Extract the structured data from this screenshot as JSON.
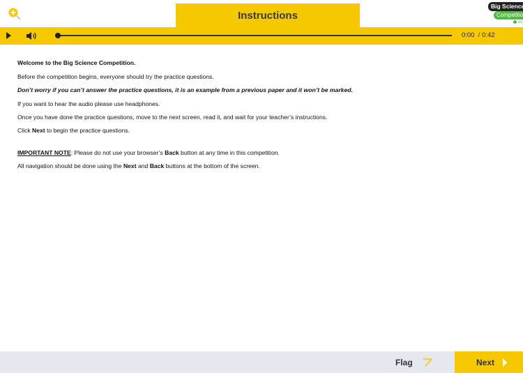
{
  "header": {
    "title": "Instructions",
    "zoom_icon": "zoom-in-icon",
    "logo": {
      "line1": "Big Science",
      "line2": "Competition",
      "line3": "online"
    }
  },
  "audio": {
    "play_icon": "play-icon",
    "volume_icon": "volume-icon",
    "current_time": "0:00",
    "duration": "/ 0:42",
    "progress": 0
  },
  "content": {
    "welcome": "Welcome to the Big Science Competition.",
    "intro": "Before the competition begins, everyone should try the practice questions.",
    "note_italic": "Don’t worry if you can’t answer the practice questions, it is an example from a previous paper and it won’t be marked.",
    "audio_hint": "If you want to hear the audio please use headphones.",
    "next_screen": "Once you have done the practice questions, move to the next screen, read it, and wait for your teacher’s instructions.",
    "click_prefix": "Click ",
    "click_next": "Next",
    "click_suffix": " to begin the practice questions.",
    "important_label": "IMPORTANT NOTE",
    "important_prefix": ": Please do not use your browser’s ",
    "important_back": "Back",
    "important_suffix": " button at any time in this competition.",
    "nav_prefix": "All navigation should be done using the ",
    "nav_next": "Next",
    "nav_and": " and ",
    "nav_back": "Back",
    "nav_suffix": " buttons at the bottom of the screen."
  },
  "footer": {
    "flag_label": "Flag",
    "flag_icon": "flag-icon",
    "next_label": "Next",
    "next_icon": "chevron-right-icon"
  },
  "colors": {
    "accent": "#f5c800",
    "footer_bg": "#e3e8ee",
    "logo_green": "#58b847"
  }
}
